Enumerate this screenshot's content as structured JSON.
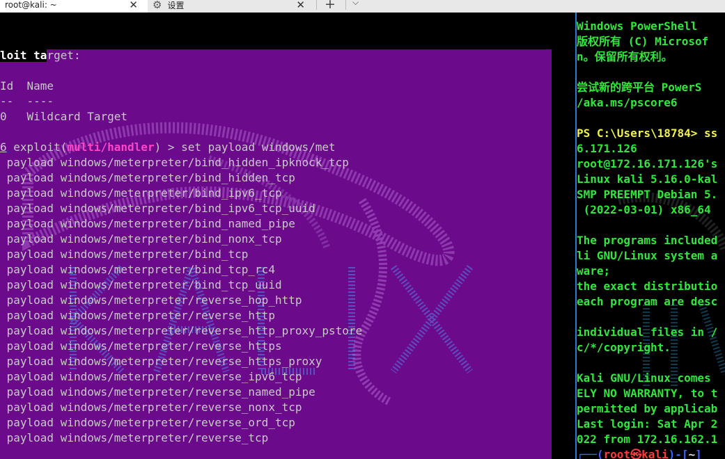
{
  "tabs": [
    {
      "label": "root@kali: ~",
      "active": true
    },
    {
      "label": "设置",
      "active": false
    }
  ],
  "tab_controls": {
    "close_glyph": "✕",
    "new_tab_glyph": "+",
    "menu_glyph": "⌵",
    "settings_glyph": "⚙"
  },
  "left_terminal": {
    "l1_a": "loit ta",
    "l1_b": "rget:",
    "l3": "Id  Name",
    "l4": "--  ----",
    "l5": "0   Wildcard Target",
    "prompt_num": "6",
    "prompt_word": " exploit(",
    "prompt_module": "multi/handler",
    "prompt_end": ") > set payload windows/met",
    "payloads": [
      "payload windows/meterpreter/bind_hidden_ipknock_tcp",
      "payload windows/meterpreter/bind_hidden_tcp",
      "payload windows/meterpreter/bind_ipv6_tcp",
      "payload windows/meterpreter/bind_ipv6_tcp_uuid",
      "payload windows/meterpreter/bind_named_pipe",
      "payload windows/meterpreter/bind_nonx_tcp",
      "payload windows/meterpreter/bind_tcp",
      "payload windows/meterpreter/bind_tcp_rc4",
      "payload windows/meterpreter/bind_tcp_uuid",
      "payload windows/meterpreter/reverse_hop_http",
      "payload windows/meterpreter/reverse_http",
      "payload windows/meterpreter/reverse_http_proxy_pstore",
      "payload windows/meterpreter/reverse_https",
      "payload windows/meterpreter/reverse_https_proxy",
      "payload windows/meterpreter/reverse_ipv6_tcp",
      "payload windows/meterpreter/reverse_named_pipe",
      "payload windows/meterpreter/reverse_nonx_tcp",
      "payload windows/meterpreter/reverse_ord_tcp",
      "payload windows/meterpreter/reverse_tcp"
    ]
  },
  "right_terminal": {
    "lines": [
      "Windows PowerShell",
      "版权所有 (C) Microsof",
      "n。保留所有权利。",
      "",
      "尝试新的跨平台 PowerS",
      "/aka.ms/pscore6",
      ""
    ],
    "ps_prompt": "PS C:\\Users\\18784> ",
    "ps_cmd": "ss",
    "lines2": [
      "6.171.126",
      "root@172.16.171.126's",
      "Linux kali 5.16.0-kal",
      "SMP PREEMPT Debian 5.",
      " (2022-03-01) x86_64",
      "",
      "The programs included",
      "li GNU/Linux system a",
      "ware;",
      "the exact distributio",
      "each program are desc",
      "",
      "individual files in /",
      "c/*/copyright.",
      "",
      "Kali GNU/Linux comes",
      "ELY NO WARRANTY, to t",
      "permitted by applicab",
      "Last login: Sat Apr 2",
      "022 from 172.16.162.1"
    ],
    "prompt_open": "┌──(",
    "prompt_user": "root㉿kali",
    "prompt_mid": ")-[",
    "prompt_dir": "~",
    "prompt_close": "]"
  },
  "colors": {
    "purple_bg": "#6c0a8c",
    "green_text": "#2fe83b",
    "accent_divider": "#2e7bd6"
  }
}
